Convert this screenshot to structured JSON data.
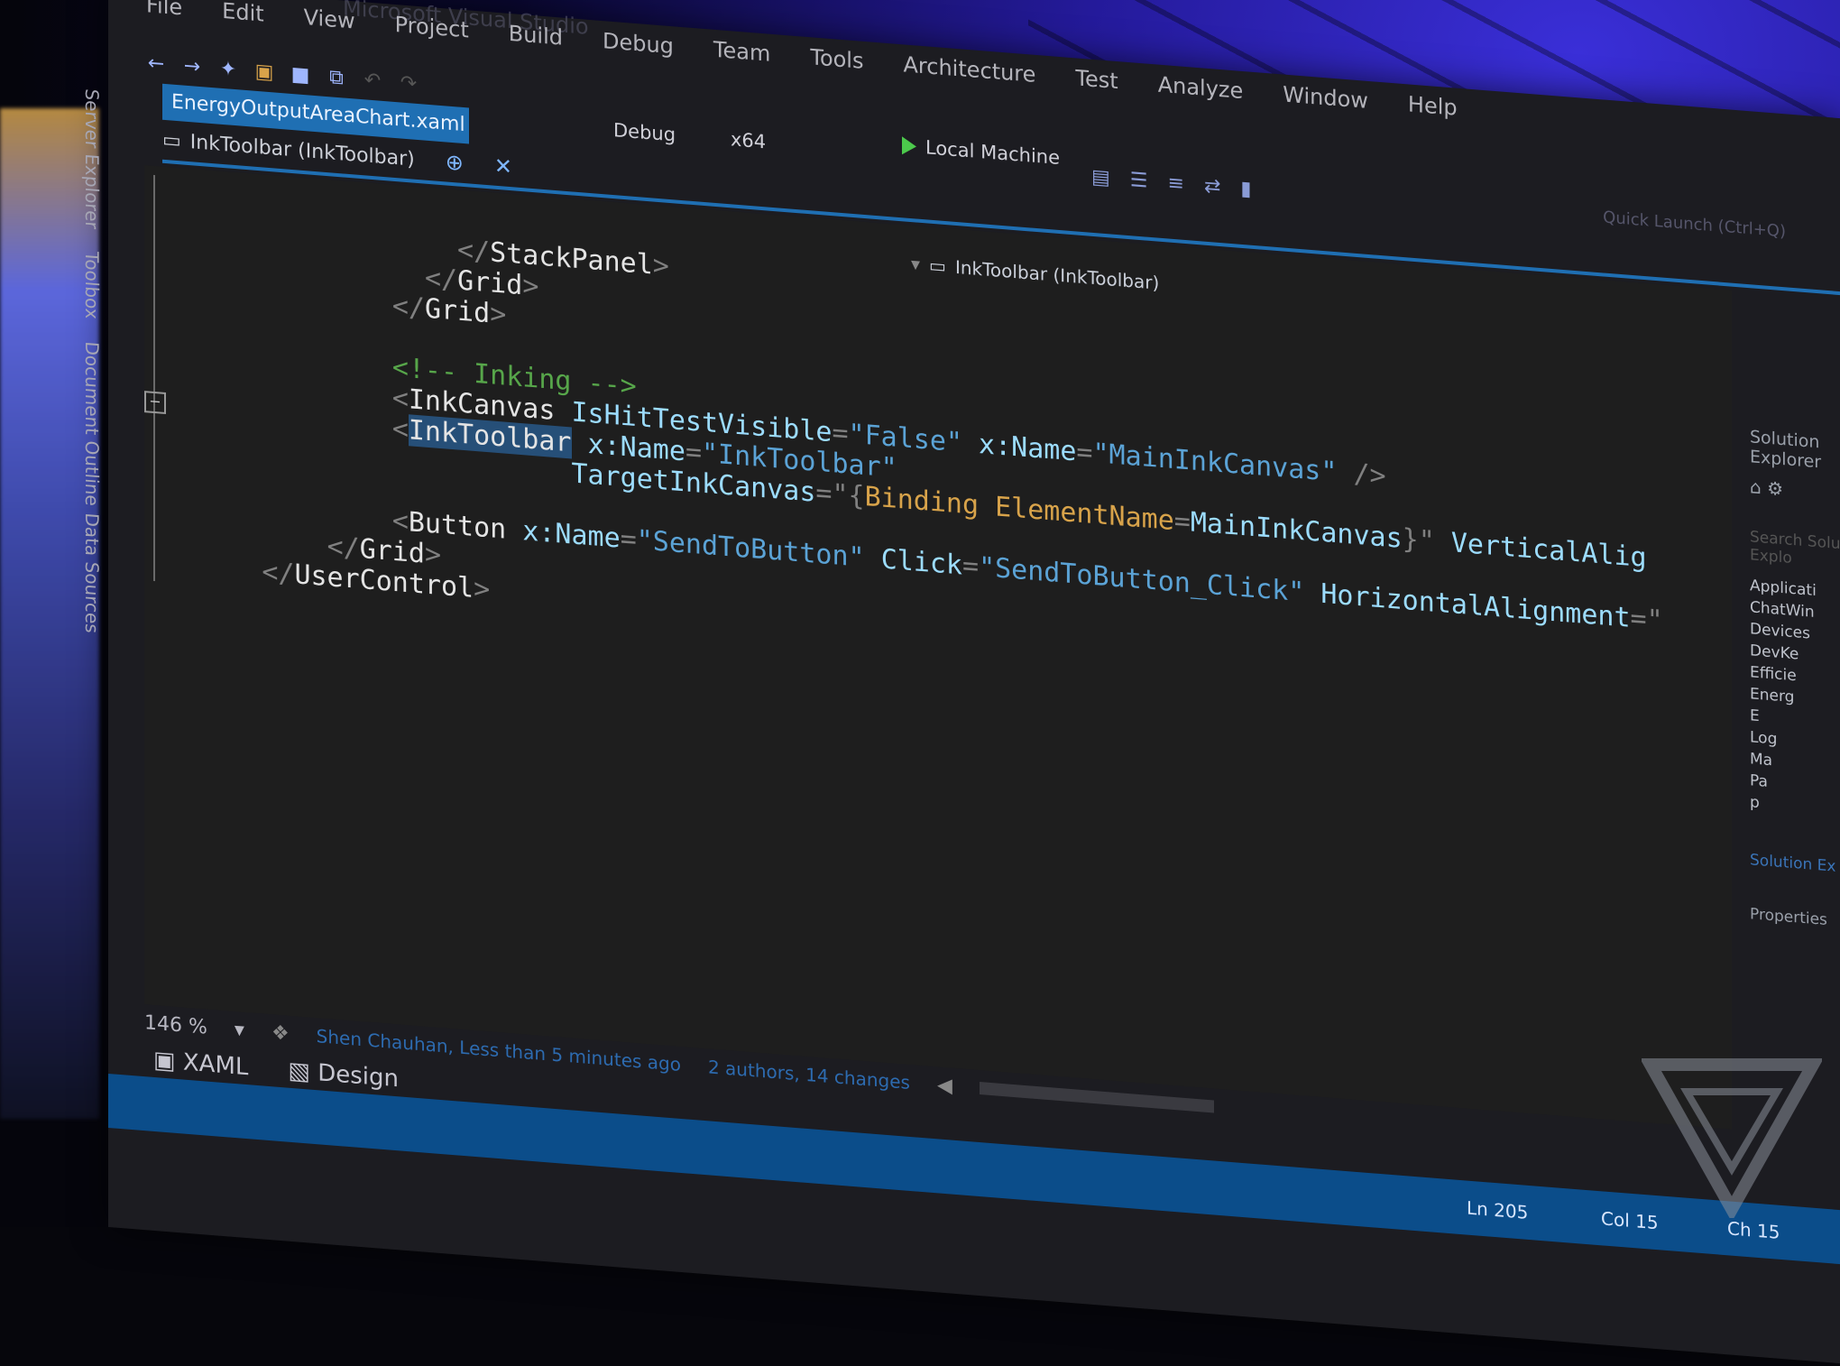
{
  "window": {
    "title": "Microsoft Visual Studio",
    "menu": [
      "File",
      "Edit",
      "View",
      "Project",
      "Build",
      "Debug",
      "Team",
      "Tools",
      "Architecture",
      "Test",
      "Analyze",
      "Window",
      "Help"
    ]
  },
  "toolbar": {
    "config": "Debug",
    "platform": "x64",
    "run_target": "Local Machine",
    "quick_launch": "Quick Launch (Ctrl+Q)"
  },
  "tabs": {
    "active_file": "EnergyOutputAreaChart.xaml",
    "element_path": "InkToolbar (InkToolbar)",
    "nav_selection": "InkToolbar (InkToolbar)"
  },
  "left_rail": [
    "Server Explorer",
    "Toolbox",
    "Document Outline",
    "Data Sources"
  ],
  "code": {
    "l1": [
      "</",
      "StackPanel",
      ">"
    ],
    "l2": [
      "</",
      "Grid",
      ">"
    ],
    "l3": [
      "</",
      "Grid",
      ">"
    ],
    "comment": "<!-- Inking -->",
    "inkcanvas": {
      "tag": "InkCanvas",
      "attr1": "IsHitTestVisible",
      "val1": "\"False\"",
      "attr2": "x:Name",
      "val2": "\"MainInkCanvas\"",
      "close": "/>"
    },
    "inktoolbar": {
      "tag": "InkToolbar",
      "attr1": "x:Name",
      "val1": "\"InkToolbar\"",
      "attr2": "TargetInkCanvas",
      "val2_open": "\"{",
      "binding": "Binding",
      "elname": "ElementName",
      "elvalue": "MainInkCanvas",
      "val2_close": "}\"",
      "extra": "VerticalAlig"
    },
    "button": {
      "tag": "Button",
      "attr1": "x:Name",
      "val1": "\"SendToButton\"",
      "attr2": "Click",
      "val2": "\"SendToButton_Click\"",
      "attr3": "HorizontalAlignment"
    },
    "end_grid": [
      "</",
      "Grid",
      ">"
    ],
    "end_uc": [
      "</",
      "UserControl",
      ">"
    ]
  },
  "solution_explorer": {
    "title": "Solution Explorer",
    "search": "Search Solution Explo",
    "items": [
      "Applicati",
      "ChatWin",
      "Devices",
      "DevKe",
      "Efficie",
      "Energ",
      "E",
      "Log",
      "Ma",
      "Pa",
      "p"
    ],
    "tab": "Solution Ex",
    "properties": "Properties"
  },
  "status": {
    "zoom": "146 %",
    "author": "Shen Chauhan, Less than 5 minutes ago",
    "changes": "2 authors, 14 changes",
    "view_xaml": "XAML",
    "view_design": "Design",
    "ln": "Ln 205",
    "col": "Col 15",
    "ch": "Ch 15"
  },
  "colors": {
    "accent": "#1f6fb3",
    "status_bar": "#0b4d8a",
    "editor_bg": "#1e1e1e",
    "comment": "#57a64a",
    "string": "#5ba3d6",
    "binding": "#d8a34a"
  }
}
